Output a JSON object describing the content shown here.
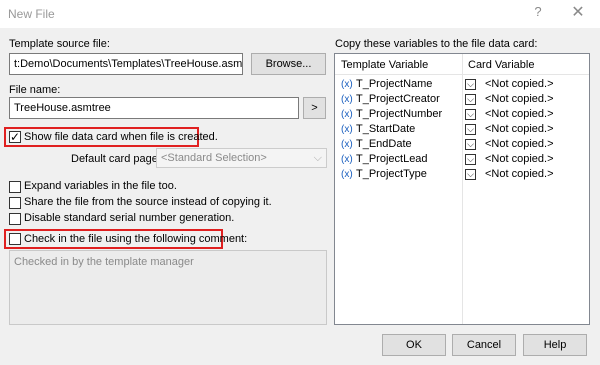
{
  "window": {
    "title": "New File",
    "help_glyph": "?",
    "close_glyph": "✕"
  },
  "template": {
    "label": "Template source file:",
    "value": "t:Demo\\Documents\\Templates\\TreeHouse.asmtree",
    "browse_label": "Browse..."
  },
  "filename": {
    "label": "File name:",
    "value": "TreeHouse.asmtree",
    "arrow_label": ">"
  },
  "options": {
    "show_card": {
      "label": "Show file data card when file is created.",
      "checked": true
    },
    "default_card_label": "Default card page:",
    "default_card_value": "<Standard Selection>",
    "expand_vars": {
      "label": "Expand variables in the file too.",
      "checked": false
    },
    "share_file": {
      "label": "Share the file from the source instead of copying it.",
      "checked": false
    },
    "disable_serial": {
      "label": "Disable standard serial number generation.",
      "checked": false
    },
    "checkin": {
      "label": "Check in the file using the following comment:",
      "checked": false
    },
    "comment_text": "Checked in by the template manager"
  },
  "variables": {
    "heading": "Copy these variables to the file data card:",
    "col_template": "Template Variable",
    "col_card": "Card Variable",
    "icon_text": "(x)",
    "rows": [
      {
        "name": "T_ProjectName",
        "card": "<Not copied.>"
      },
      {
        "name": "T_ProjectCreator",
        "card": "<Not copied.>"
      },
      {
        "name": "T_ProjectNumber",
        "card": "<Not copied.>"
      },
      {
        "name": "T_StartDate",
        "card": "<Not copied.>"
      },
      {
        "name": "T_EndDate",
        "card": "<Not copied.>"
      },
      {
        "name": "T_ProjectLead",
        "card": "<Not copied.>"
      },
      {
        "name": "T_ProjectType",
        "card": "<Not copied.>"
      }
    ]
  },
  "footer": {
    "ok": "OK",
    "cancel": "Cancel",
    "help": "Help"
  },
  "colors": {
    "highlight": "#e02020",
    "icon_blue": "#1a5fbf"
  }
}
